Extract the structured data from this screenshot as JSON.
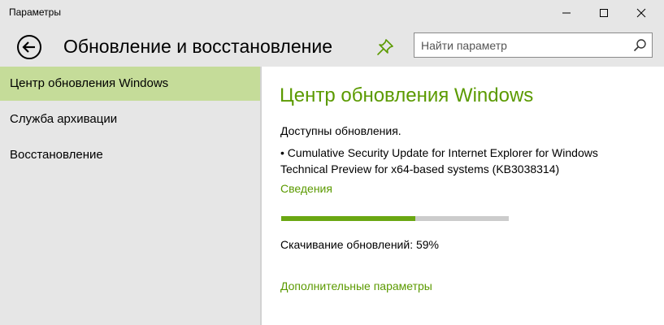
{
  "window": {
    "title": "Параметры"
  },
  "header": {
    "page_title": "Обновление и восстановление"
  },
  "search": {
    "placeholder": "Найти параметр",
    "value": ""
  },
  "sidebar": {
    "items": [
      {
        "label": "Центр обновления Windows",
        "active": true
      },
      {
        "label": "Служба архивации",
        "active": false
      },
      {
        "label": "Восстановление",
        "active": false
      }
    ]
  },
  "main": {
    "section_title": "Центр обновления Windows",
    "status": "Доступны обновления.",
    "update_item": "• Cumulative Security Update for Internet Explorer for Windows Technical Preview for x64-based systems (KB3038314)",
    "details_link": "Сведения",
    "progress_percent": 59,
    "progress_text": "Скачивание обновлений: 59%",
    "advanced_link": "Дополнительные параметры"
  },
  "icons": {
    "back": "back-arrow-icon",
    "pin": "pin-icon",
    "search": "search-icon",
    "minimize": "minimize-icon",
    "maximize": "maximize-icon",
    "close": "close-icon"
  },
  "colors": {
    "accent": "#5b9a00",
    "progress": "#6aa712",
    "progress_track": "#cccccc",
    "sidebar_active": "#c5dc99",
    "chrome": "#e6e6e6",
    "content_bg": "#ffffff"
  }
}
